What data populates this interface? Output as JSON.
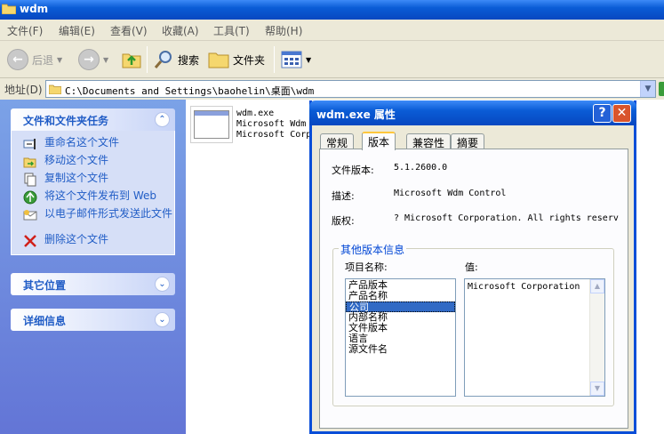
{
  "window": {
    "title": "wdm"
  },
  "menu": {
    "items": [
      "文件(F)",
      "编辑(E)",
      "查看(V)",
      "收藏(A)",
      "工具(T)",
      "帮助(H)"
    ]
  },
  "toolbar": {
    "back_label": "后退",
    "search_label": "搜索",
    "folders_label": "文件夹"
  },
  "address": {
    "label": "地址(D)",
    "path": "C:\\Documents and Settings\\baohelin\\桌面\\wdm"
  },
  "taskpane": {
    "file_tasks": {
      "title": "文件和文件夹任务",
      "items": [
        "重命名这个文件",
        "移动这个文件",
        "复制这个文件",
        "将这个文件发布到 Web",
        "以电子邮件形式发送此文件",
        "删除这个文件"
      ]
    },
    "other_places": {
      "title": "其它位置"
    },
    "details": {
      "title": "详细信息"
    }
  },
  "file": {
    "name": "wdm.exe",
    "line2": "Microsoft Wdm",
    "line3": "Microsoft Corp"
  },
  "dialog": {
    "title": "wdm.exe 属性",
    "tabs": [
      "常规",
      "版本",
      "兼容性",
      "摘要"
    ],
    "selected_tab": "版本",
    "file_version_label": "文件版本:",
    "file_version": "5.1.2600.0",
    "description_label": "描述:",
    "description": "Microsoft Wdm Control",
    "copyright_label": "版权:",
    "copyright": "? Microsoft Corporation. All rights reserv",
    "group_title": "其他版本信息",
    "item_name_label": "项目名称:",
    "value_label": "值:",
    "items": [
      "产品版本",
      "产品名称",
      "公司",
      "内部名称",
      "文件版本",
      "语言",
      "源文件名"
    ],
    "selected_item": "公司",
    "value": "Microsoft Corporation"
  },
  "colors": {
    "titlebar": "#0a5cd6",
    "taskpane": "#7ba2e7",
    "task_link": "#215dc6",
    "selection": "#316ac5"
  }
}
